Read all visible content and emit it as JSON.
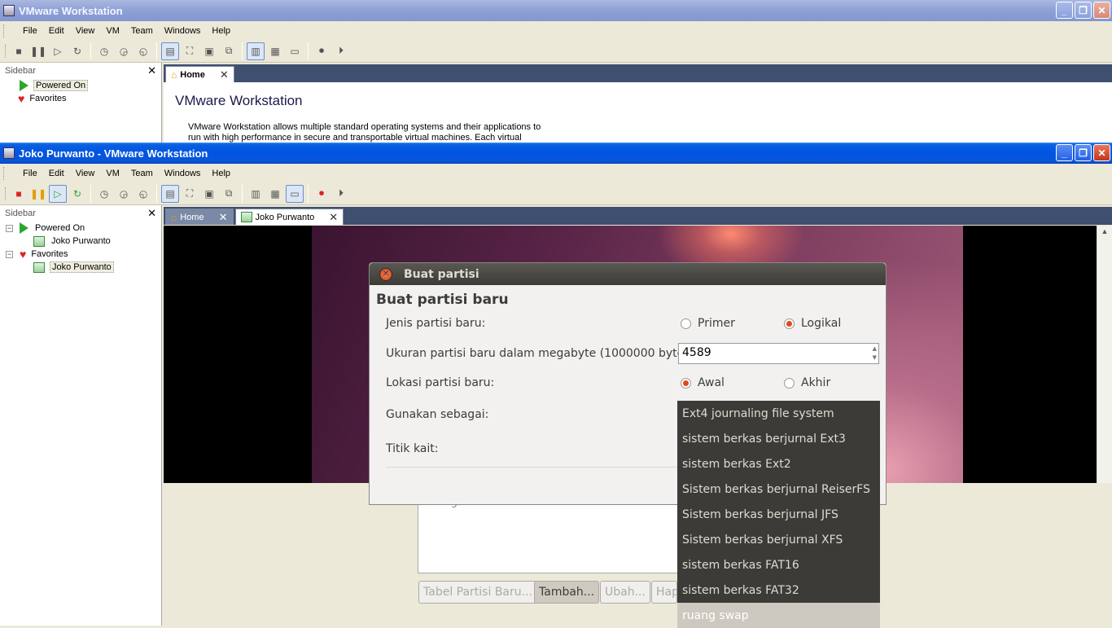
{
  "win1": {
    "title": "VMware Workstation",
    "menu": [
      "File",
      "Edit",
      "View",
      "VM",
      "Team",
      "Windows",
      "Help"
    ],
    "sidebar": {
      "title": "Sidebar",
      "items": [
        "Powered On",
        "Favorites"
      ]
    },
    "tabs": {
      "home": "Home"
    },
    "home": {
      "heading": "VMware Workstation",
      "line1": "VMware Workstation allows multiple standard operating systems and their applications to",
      "line2": "run with high performance in secure and transportable virtual machines. Each virtual"
    }
  },
  "win2": {
    "title": "Joko Purwanto - VMware Workstation",
    "menu": [
      "File",
      "Edit",
      "View",
      "VM",
      "Team",
      "Windows",
      "Help"
    ],
    "sidebar": {
      "title": "Sidebar",
      "powered_on": "Powered On",
      "powered_vm": "Joko Purwanto",
      "favorites": "Favorites",
      "favorite_vm": "Joko Purwanto"
    },
    "tabs": {
      "home": "Home",
      "vm": "Joko Purwanto"
    }
  },
  "guest": {
    "background_buttons": [
      "Tabel Partisi Baru...",
      "Tambah...",
      "Ubah...",
      "Hap"
    ],
    "background_row": "ruang bebas",
    "dialog": {
      "title": "Buat partisi",
      "heading": "Buat partisi baru",
      "type_label": "Jenis partisi baru:",
      "type_primary": "Primer",
      "type_logical": "Logikal",
      "type_selected": "Logikal",
      "size_label": "Ukuran partisi baru dalam megabyte (1000000 byte):",
      "size_value": "4589",
      "location_label": "Lokasi partisi baru:",
      "location_begin": "Awal",
      "location_end": "Akhir",
      "location_selected": "Awal",
      "use_as_label": "Gunakan sebagai:",
      "mount_label": "Titik kait:"
    },
    "use_as_options": [
      "Ext4 journaling file system",
      "sistem berkas berjurnal Ext3",
      "sistem berkas Ext2",
      "Sistem berkas berjurnal ReiserFS",
      "Sistem berkas berjurnal JFS",
      "Sistem berkas berjurnal XFS",
      "sistem berkas FAT16",
      "sistem berkas FAT32",
      "ruang swap"
    ],
    "use_as_highlighted": "ruang swap"
  },
  "colors": {
    "xp_title": "#0054e3",
    "ubuntu_accent": "#e04a1a",
    "dropdown_bg": "#3c3b37"
  }
}
